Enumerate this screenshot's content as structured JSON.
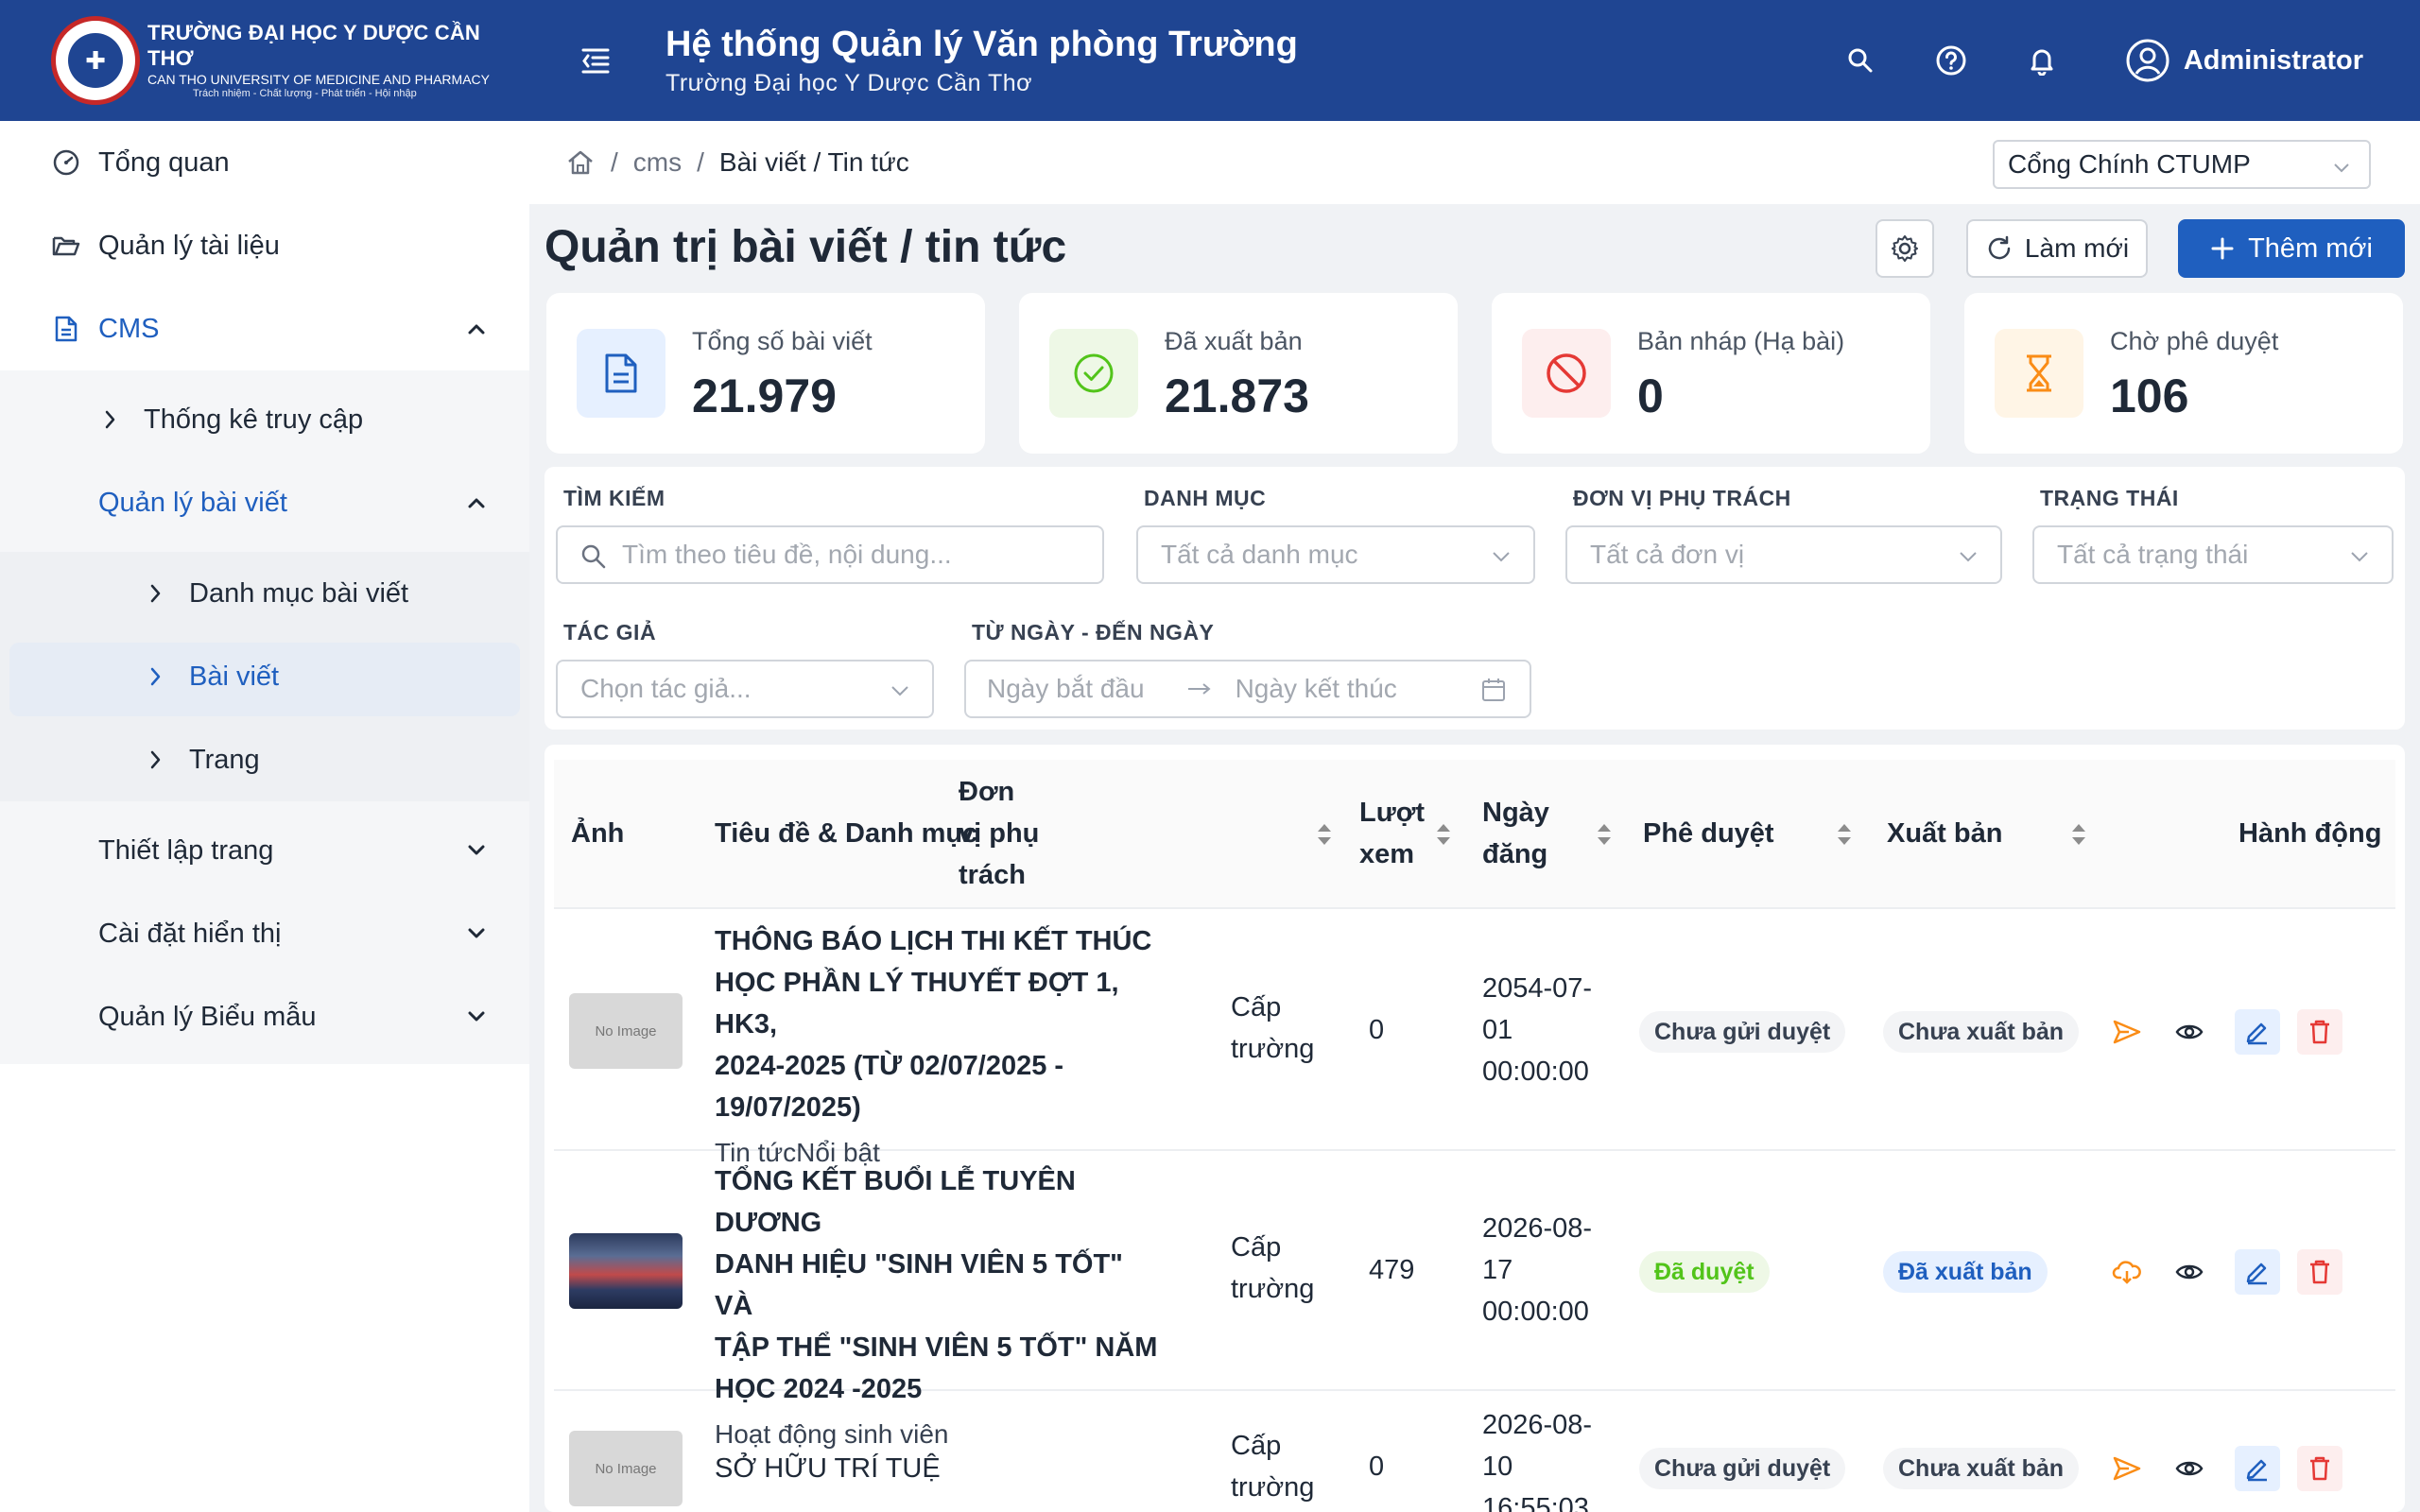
{
  "header": {
    "logo_line1": "TRƯỜNG ĐẠI HỌC Y DƯỢC CẦN THƠ",
    "logo_line2": "CAN THO UNIVERSITY OF MEDICINE AND PHARMACY",
    "logo_line3": "Trách nhiệm - Chất lượng - Phát triển - Hội nhập",
    "title": "Hệ thống Quản lý Văn phòng Trường",
    "subtitle": "Trường Đại học Y Dược Cần Thơ",
    "user_name": "Administrator"
  },
  "sidebar": {
    "overview": "Tổng quan",
    "documents": "Quản lý tài liệu",
    "cms": "CMS",
    "access_stats": "Thống kê truy cập",
    "post_management": "Quản lý bài viết",
    "post_categories": "Danh mục bài viết",
    "posts": "Bài viết",
    "pages": "Trang",
    "page_setup": "Thiết lập trang",
    "display_settings": "Cài đặt hiển thị",
    "forms": "Quản lý Biểu mẫu"
  },
  "breadcrumb": {
    "sep": "/",
    "cms": "cms",
    "current": "Bài viết / Tin tức"
  },
  "portal_select": {
    "value": "Cổng Chính CTUMP"
  },
  "page": {
    "title": "Quản trị bài viết / tin tức",
    "refresh_label": "Làm mới",
    "add_label": "Thêm mới"
  },
  "stats": [
    {
      "label": "Tổng số bài viết",
      "value": "21.979",
      "color": "#1f5fbf"
    },
    {
      "label": "Đã xuất bản",
      "value": "21.873",
      "color": "#52c41a"
    },
    {
      "label": "Bản nháp (Hạ bài)",
      "value": "0",
      "color": "#e53935"
    },
    {
      "label": "Chờ phê duyệt",
      "value": "106",
      "color": "#fa8c16"
    }
  ],
  "filters": {
    "search_label": "TÌM KIẾM",
    "search_placeholder": "Tìm theo tiêu đề, nội dung...",
    "category_label": "DANH MỤC",
    "category_value": "Tất cả danh mục",
    "unit_label": "ĐƠN VỊ PHỤ TRÁCH",
    "unit_value": "Tất cả đơn vị",
    "status_label": "TRẠNG THÁI",
    "status_value": "Tất cả trạng thái",
    "author_label": "TÁC GIẢ",
    "author_value": "Chọn tác giả...",
    "date_label": "TỪ NGÀY - ĐẾN NGÀY",
    "date_start": "Ngày bắt đầu",
    "date_end": "Ngày kết thúc"
  },
  "table": {
    "columns": {
      "image": "Ảnh",
      "title": "Tiêu đề & Danh mục",
      "unit_l1": "Đơn",
      "unit_l2": "vị phụ",
      "unit_l3": "trách",
      "views_l1": "Lượt",
      "views_l2": "xem",
      "date_l1": "Ngày",
      "date_l2": "đăng",
      "approval": "Phê duyệt",
      "publish": "Xuất bản",
      "actions": "Hành động"
    },
    "no_image": "No Image",
    "rows": [
      {
        "title_lines": [
          "THÔNG BÁO LỊCH THI KẾT THÚC",
          "HỌC PHẦN LÝ THUYẾT ĐỢT 1, HK3,",
          "2024-2025 (TỪ 02/07/2025 -",
          "19/07/2025)"
        ],
        "category": "Tin tứcNổi bật",
        "unit_lines": [
          "Cấp",
          "trường"
        ],
        "views": "0",
        "date_lines": [
          "2054-07-",
          "01",
          "00:00:00"
        ],
        "approval": "Chưa gửi duyệt",
        "publish": "Chưa xuất bản"
      },
      {
        "title_lines": [
          "TỔNG KẾT BUỔI LỄ TUYÊN DƯƠNG",
          "DANH HIỆU \"SINH VIÊN 5 TỐT\" VÀ",
          "TẬP THỂ \"SINH VIÊN 5 TỐT\" NĂM",
          "HỌC 2024 -2025"
        ],
        "category": "Hoạt động sinh viên",
        "unit_lines": [
          "Cấp",
          "trường"
        ],
        "views": "479",
        "date_lines": [
          "2026-08-",
          "17",
          "00:00:00"
        ],
        "approval": "Đã duyệt",
        "publish": "Đã xuất bản"
      },
      {
        "title_lines": [
          "SỞ HỮU TRÍ TUỆ"
        ],
        "category": "",
        "unit_lines": [
          "Cấp",
          "trường"
        ],
        "views": "0",
        "date_lines": [
          "2026-08-",
          "10",
          "16:55:03"
        ],
        "approval": "Chưa gửi duyệt",
        "publish": "Chưa xuất bản"
      }
    ]
  }
}
